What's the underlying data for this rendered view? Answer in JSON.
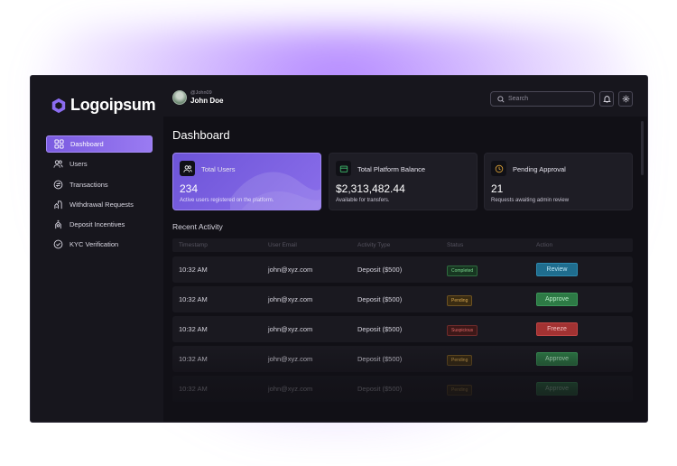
{
  "brand": {
    "logo_text": "Logoipsum",
    "accent": "#8b6cf0"
  },
  "sidebar": {
    "items": [
      {
        "label": "Dashboard",
        "icon": "grid-icon",
        "active": true
      },
      {
        "label": "Users",
        "icon": "users-icon"
      },
      {
        "label": "Transactions",
        "icon": "transactions-icon"
      },
      {
        "label": "Withdrawal Requests",
        "icon": "withdrawal-icon"
      },
      {
        "label": "Deposit Incentives",
        "icon": "deposit-icon"
      },
      {
        "label": "KYC Verification",
        "icon": "check-circle-icon"
      }
    ]
  },
  "header": {
    "user_handle": "@John09",
    "user_name": "John Doe",
    "search_placeholder": "Search"
  },
  "page": {
    "title": "Dashboard"
  },
  "cards": [
    {
      "title": "Total Users",
      "value": "234",
      "sub": "Active users registered on the platform.",
      "icon": "users-icon"
    },
    {
      "title": "Total Platform Balance",
      "value": "$2,313,482.44",
      "sub": "Available for transfers.",
      "icon": "wallet-icon"
    },
    {
      "title": "Pending Approval",
      "value": "21",
      "sub": "Requests awaiting admin review",
      "icon": "clock-icon"
    }
  ],
  "activity": {
    "title": "Recent Activity",
    "columns": [
      "Timestamp",
      "User Email",
      "Activity Type",
      "Status",
      "Action"
    ],
    "rows": [
      {
        "time": "10:32 AM",
        "email": "john@xyz.com",
        "type": "Deposit ($500)",
        "status": "Completed",
        "action": "Review"
      },
      {
        "time": "10:32 AM",
        "email": "john@xyz.com",
        "type": "Deposit ($500)",
        "status": "Pending",
        "action": "Approve"
      },
      {
        "time": "10:32 AM",
        "email": "john@xyz.com",
        "type": "Deposit ($500)",
        "status": "Suspicious",
        "action": "Freeze"
      },
      {
        "time": "10:32 AM",
        "email": "john@xyz.com",
        "type": "Deposit ($500)",
        "status": "Pending",
        "action": "Approve"
      },
      {
        "time": "10:32 AM",
        "email": "john@xyz.com",
        "type": "Deposit ($500)",
        "status": "Pending",
        "action": "Approve"
      }
    ]
  }
}
